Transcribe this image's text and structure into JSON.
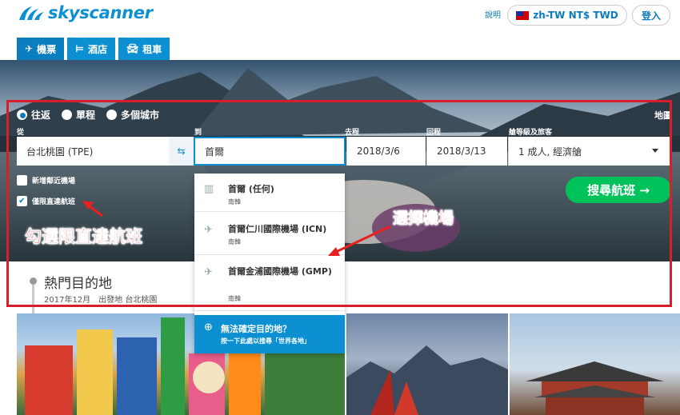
{
  "header": {
    "logo_text": "skyscanner",
    "help": "說明",
    "locale": "zh-TW NT$ TWD",
    "login": "登入"
  },
  "tabs": [
    {
      "icon": "plane-icon",
      "label": "機票"
    },
    {
      "icon": "bed-icon",
      "label": "酒店"
    },
    {
      "icon": "car-icon",
      "label": "租車"
    }
  ],
  "search": {
    "trip_types": [
      "往返",
      "單程",
      "多個城市"
    ],
    "selected_trip_type": "往返",
    "map_link": "地圖",
    "labels": {
      "from": "從",
      "to": "到",
      "depart": "去程",
      "return": "回程",
      "cabin": "艙等級及旅客"
    },
    "from_value": "台北桃園 (TPE)",
    "to_value": "首爾",
    "depart_value": "2018/3/6",
    "return_value": "2018/3/13",
    "cabin_value": "1 成人, 經濟艙",
    "nearby_airports": "新增鄰近機場",
    "direct_only": "僅限直達航班",
    "direct_only_checked": true,
    "search_button": "搜尋航班 →"
  },
  "dropdown": {
    "items": [
      {
        "icon": "city-icon",
        "title": "首爾 (任何)",
        "subtitle": "南韓"
      },
      {
        "icon": "plane-icon",
        "title": "首爾仁川國際機場 (ICN)",
        "subtitle": "南韓"
      },
      {
        "icon": "plane-icon",
        "title": "首爾金浦國際機場 (GMP)",
        "subtitle": "南韓"
      }
    ],
    "footer_title": "無法確定目的地？",
    "footer_sub": "按一下此處以搜尋「世界各地」"
  },
  "annotations": {
    "direct": "勾選限直達航班",
    "airport": "選擇機場"
  },
  "popular": {
    "title": "熱門目的地",
    "subtitle": "2017年12月　出發地 台北桃園"
  },
  "colors": {
    "brand": "#0c90d2",
    "search_green": "#00c25a",
    "annotation_red": "#e8201f"
  }
}
